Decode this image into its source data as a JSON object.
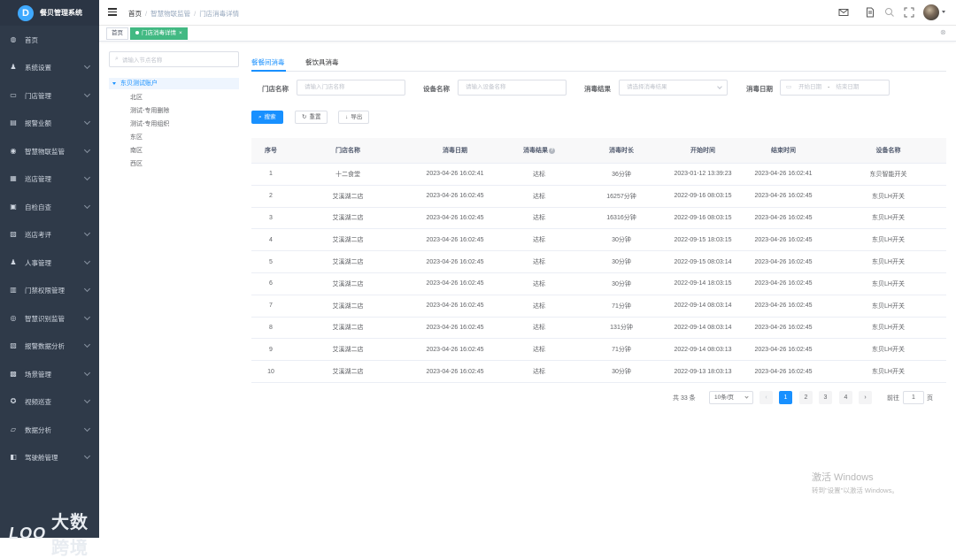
{
  "app": {
    "title": "餐贝管理系统",
    "logo_letter": "D"
  },
  "sidebar": {
    "items": [
      {
        "label": "首页",
        "icon": "dashboard-icon",
        "glyph": "◍",
        "chevron": false
      },
      {
        "label": "系统设置",
        "icon": "user-icon",
        "glyph": "♟",
        "chevron": true
      },
      {
        "label": "门店管理",
        "icon": "store-icon",
        "glyph": "▭",
        "chevron": true
      },
      {
        "label": "报警业额",
        "icon": "report-icon",
        "glyph": "▤",
        "chevron": true
      },
      {
        "label": "智慧物联监管",
        "icon": "iot-icon",
        "glyph": "◉",
        "chevron": true
      },
      {
        "label": "巡店管理",
        "icon": "grid-icon",
        "glyph": "▦",
        "chevron": true
      },
      {
        "label": "自检自查",
        "icon": "check-icon",
        "glyph": "▣",
        "chevron": true
      },
      {
        "label": "巡店考评",
        "icon": "evaluate-icon",
        "glyph": "▨",
        "chevron": true
      },
      {
        "label": "人事管理",
        "icon": "person-icon",
        "glyph": "♟",
        "chevron": true
      },
      {
        "label": "门禁权限管理",
        "icon": "door-icon",
        "glyph": "▥",
        "chevron": true
      },
      {
        "label": "智慧识别监管",
        "icon": "camera-icon",
        "glyph": "◎",
        "chevron": true
      },
      {
        "label": "报警数据分析",
        "icon": "chart-icon",
        "glyph": "▧",
        "chevron": true
      },
      {
        "label": "场景管理",
        "icon": "scene-icon",
        "glyph": "▩",
        "chevron": true
      },
      {
        "label": "视频巡查",
        "icon": "video-icon",
        "glyph": "✪",
        "chevron": true
      },
      {
        "label": "数据分析",
        "icon": "analysis-icon",
        "glyph": "▱",
        "chevron": true
      },
      {
        "label": "驾驶舱管理",
        "icon": "cockpit-icon",
        "glyph": "◧",
        "chevron": true
      }
    ]
  },
  "watermark": {
    "logo": "LOO",
    "text": "大数跨境"
  },
  "header": {
    "breadcrumb": [
      "首页",
      "智慧物联监管",
      "门店消毒详情"
    ]
  },
  "tags": {
    "home": "首页",
    "active": "门店消毒详情",
    "close": "×"
  },
  "tree": {
    "search_placeholder": "请输入节点名称",
    "root": "东贝测试账户",
    "children": [
      "北区",
      "测试-专用删除",
      "测试-专用组织",
      "东区",
      "南区",
      "西区"
    ]
  },
  "tabs": [
    "餐餐间消毒",
    "餐饮具消毒"
  ],
  "filters": {
    "store_label": "门店名称",
    "store_placeholder": "请输入门店名称",
    "device_label": "设备名称",
    "device_placeholder": "请输入设备名称",
    "result_label": "消毒结果",
    "result_placeholder": "请选择消毒结果",
    "date_label": "消毒日期",
    "date_start": "开始日期",
    "date_sep": "-",
    "date_end": "结束日期"
  },
  "buttons": {
    "search": "搜索",
    "reset": "重置",
    "export": "导出"
  },
  "table": {
    "headers": [
      "序号",
      "门店名称",
      "消毒日期",
      "消毒结果",
      "消毒时长",
      "开始时间",
      "结束时间",
      "设备名称"
    ],
    "rows": [
      [
        "1",
        "十二食堂",
        "2023-04-26 16:02:41",
        "达标",
        "36分钟",
        "2023-01-12 13:39:23",
        "2023-04-26 16:02:41",
        "东贝智能开关"
      ],
      [
        "2",
        "艾溪湖二店",
        "2023-04-26 16:02:45",
        "达标",
        "16257分钟",
        "2022-09-16 08:03:15",
        "2023-04-26 16:02:45",
        "东贝LH开关"
      ],
      [
        "3",
        "艾溪湖二店",
        "2023-04-26 16:02:45",
        "达标",
        "16316分钟",
        "2022-09-16 08:03:15",
        "2023-04-26 16:02:45",
        "东贝LH开关"
      ],
      [
        "4",
        "艾溪湖二店",
        "2023-04-26 16:02:45",
        "达标",
        "30分钟",
        "2022-09-15 18:03:15",
        "2023-04-26 16:02:45",
        "东贝LH开关"
      ],
      [
        "5",
        "艾溪湖二店",
        "2023-04-26 16:02:45",
        "达标",
        "30分钟",
        "2022-09-15 08:03:14",
        "2023-04-26 16:02:45",
        "东贝LH开关"
      ],
      [
        "6",
        "艾溪湖二店",
        "2023-04-26 16:02:45",
        "达标",
        "30分钟",
        "2022-09-14 18:03:15",
        "2023-04-26 16:02:45",
        "东贝LH开关"
      ],
      [
        "7",
        "艾溪湖二店",
        "2023-04-26 16:02:45",
        "达标",
        "71分钟",
        "2022-09-14 08:03:14",
        "2023-04-26 16:02:45",
        "东贝LH开关"
      ],
      [
        "8",
        "艾溪湖二店",
        "2023-04-26 16:02:45",
        "达标",
        "131分钟",
        "2022-09-14 08:03:14",
        "2023-04-26 16:02:45",
        "东贝LH开关"
      ],
      [
        "9",
        "艾溪湖二店",
        "2023-04-26 16:02:45",
        "达标",
        "71分钟",
        "2022-09-14 08:03:13",
        "2023-04-26 16:02:45",
        "东贝LH开关"
      ],
      [
        "10",
        "艾溪湖二店",
        "2023-04-26 16:02:45",
        "达标",
        "30分钟",
        "2022-09-13 18:03:13",
        "2023-04-26 16:02:45",
        "东贝LH开关"
      ]
    ]
  },
  "pagination": {
    "total": "共 33 条",
    "page_size": "10条/页",
    "pages": [
      "1",
      "2",
      "3",
      "4"
    ],
    "current": "1",
    "goto_label": "前往",
    "goto_value": "1",
    "goto_suffix": "页",
    "prev": "‹",
    "next": "›"
  },
  "windows_activation": {
    "line1": "激活 Windows",
    "line2": "转到\"设置\"以激活 Windows。"
  },
  "colors": {
    "sidebar_bg": "#2f3a49",
    "primary": "#1890ff",
    "tag_active": "#42b983"
  }
}
